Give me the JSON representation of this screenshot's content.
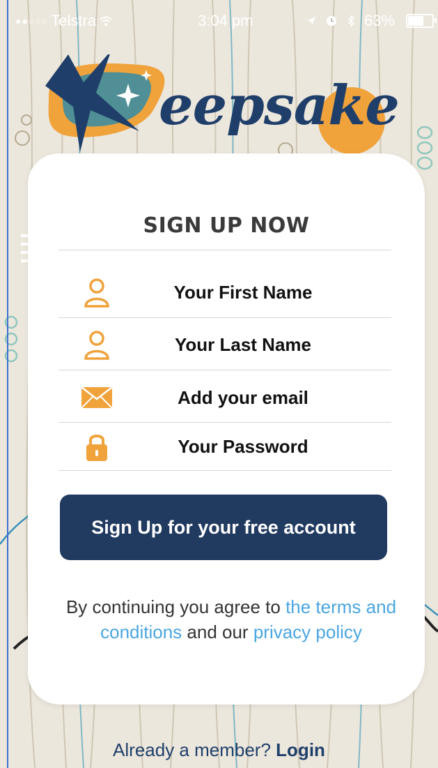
{
  "status_bar": {
    "carrier": "Telstra",
    "time": "3:04 pm",
    "battery": "63%"
  },
  "app": {
    "logo_text": "eepsake"
  },
  "form": {
    "title": "SIGN UP NOW",
    "fields": [
      {
        "label": "Your First Name",
        "icon": "person-icon"
      },
      {
        "label": "Your Last Name",
        "icon": "person-icon"
      },
      {
        "label": "Add your email",
        "icon": "envelope-icon"
      },
      {
        "label": "Your Password",
        "icon": "lock-icon"
      }
    ],
    "signup_label": "Sign Up for your free account",
    "legal": {
      "prefix": "By continuing you agree to ",
      "terms_link": "the terms and conditions",
      "middle": " and our ",
      "privacy_link": "privacy policy"
    }
  },
  "footer": {
    "prompt": "Already a member?",
    "login_label": "Login"
  },
  "colors": {
    "brand_navy": "#213a60",
    "accent_orange": "#f0a23b",
    "link_blue": "#4aa6e0"
  }
}
